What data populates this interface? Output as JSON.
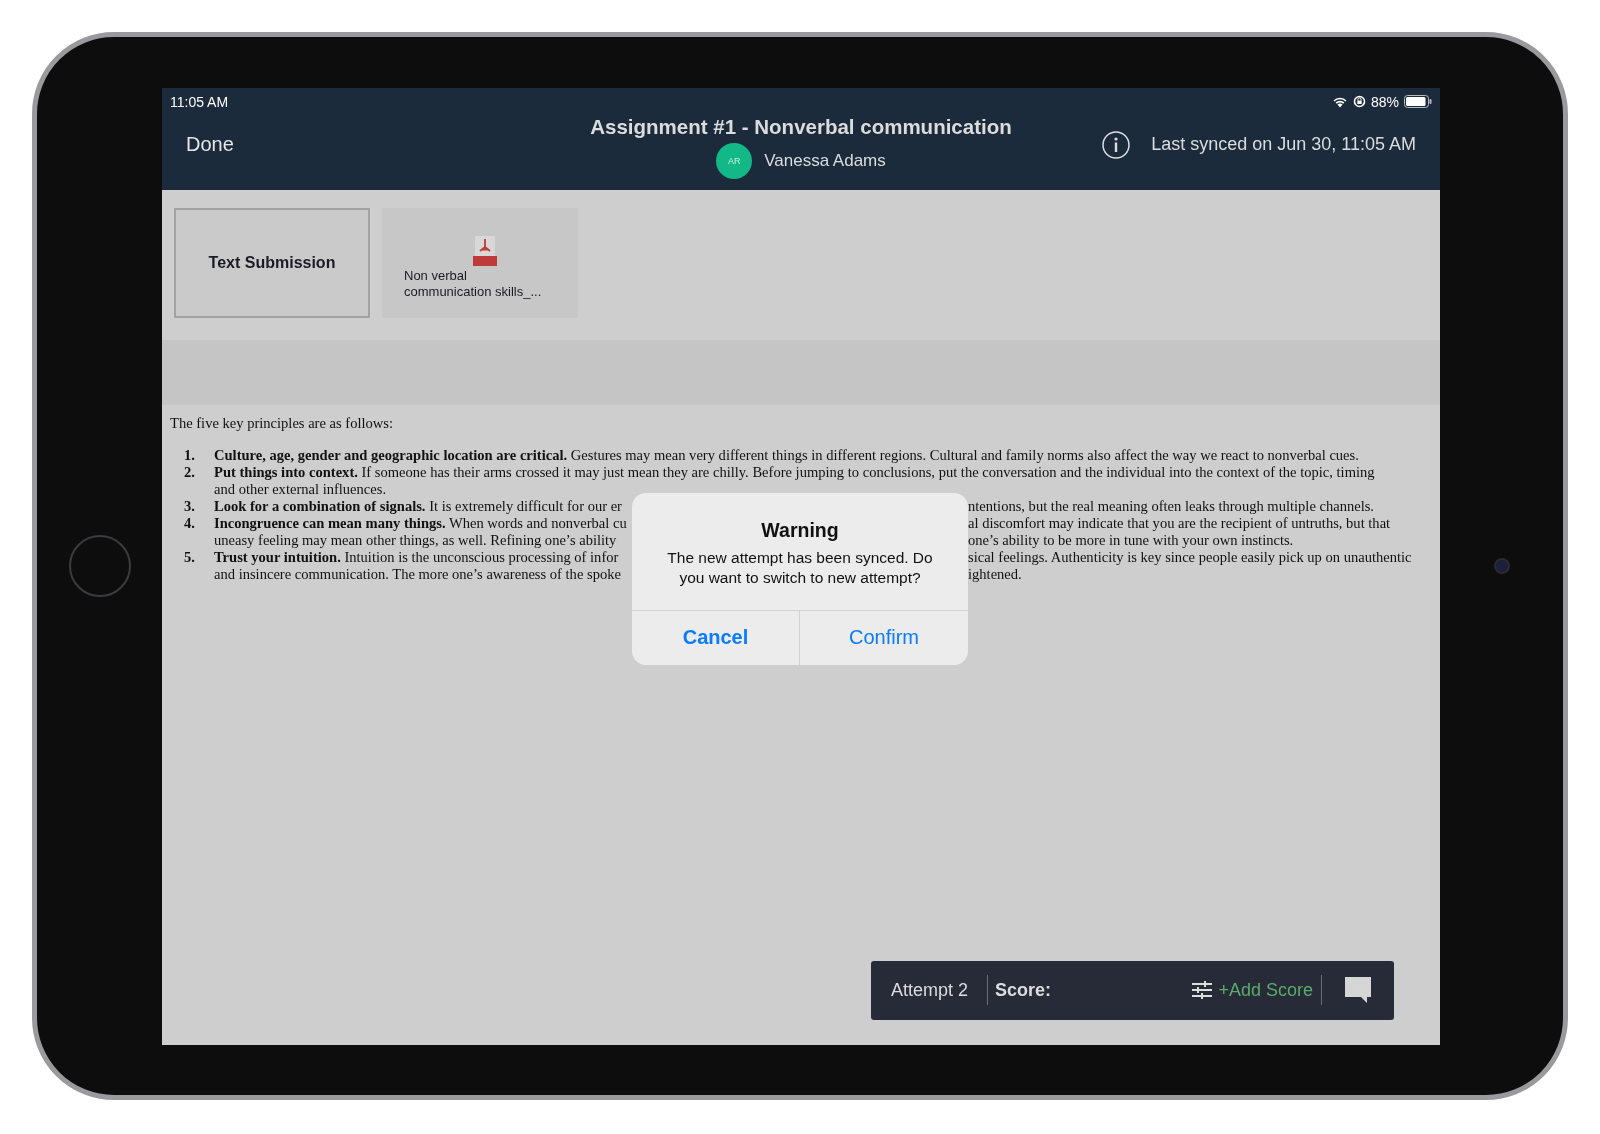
{
  "status_bar": {
    "time": "11:05 AM",
    "battery": "88%"
  },
  "header": {
    "done": "Done",
    "title": "Assignment #1 - Nonverbal communication",
    "student": {
      "initials": "AR",
      "name": "Vanessa Adams"
    },
    "sync_status": "Last synced on Jun 30, 11:05 AM"
  },
  "submission_tabs": [
    {
      "kind": "text",
      "label": "Text Submission",
      "selected": true
    },
    {
      "kind": "pdf",
      "label": "Non verbal communication skills_...",
      "selected": false
    }
  ],
  "document": {
    "intro": "The five key principles are as follows:",
    "items": [
      {
        "number": "1.",
        "lines": [
          {
            "left": "**Culture, age, gender and geographic location are critical.** Gestures may mean very different things in different regions. Cultural and family norms also affect the way we react to nonverbal cues."
          }
        ]
      },
      {
        "number": "2.",
        "lines": [
          {
            "left": "**Put things into context.** If someone has their arms crossed it may just mean they are chilly. Before jumping to conclusions, put the conversation and the individual into the context of the topic, timing"
          },
          {
            "left": "and other external influences."
          }
        ]
      },
      {
        "number": "3.",
        "lines": [
          {
            "left": "**Look for a combination of signals.** It is extremely difficult for our er",
            "right": "ntentions, but the real meaning often leaks through multiple channels."
          }
        ]
      },
      {
        "number": "4.",
        "lines": [
          {
            "left": "**Incongruence can mean many things.** When words and nonverbal cu",
            "right": "al discomfort may indicate that you are the recipient of untruths, but that"
          },
          {
            "left": "uneasy feeling may mean other things, as well. Refining one’s ability",
            "right": "one’s ability to be more in tune with your own instincts."
          }
        ]
      },
      {
        "number": "5.",
        "lines": [
          {
            "left": "**Trust your intuition.** Intuition is the unconscious processing of infor",
            "right": "sical feelings. Authenticity is key since people easily pick up on unauthentic"
          },
          {
            "left": "and insincere communication. The more one’s awareness of the spoke",
            "right": "ightened."
          }
        ]
      }
    ]
  },
  "dialog": {
    "title": "Warning",
    "message": "The new attempt has been synced. Do you want to switch to new attempt?",
    "buttons": [
      {
        "kind": "cancel",
        "label": "Cancel"
      },
      {
        "kind": "confirm",
        "label": "Confirm"
      }
    ]
  },
  "grading_bar": {
    "attempt": "Attempt 2",
    "score_label": "Score:",
    "add_score": "+Add Score"
  }
}
